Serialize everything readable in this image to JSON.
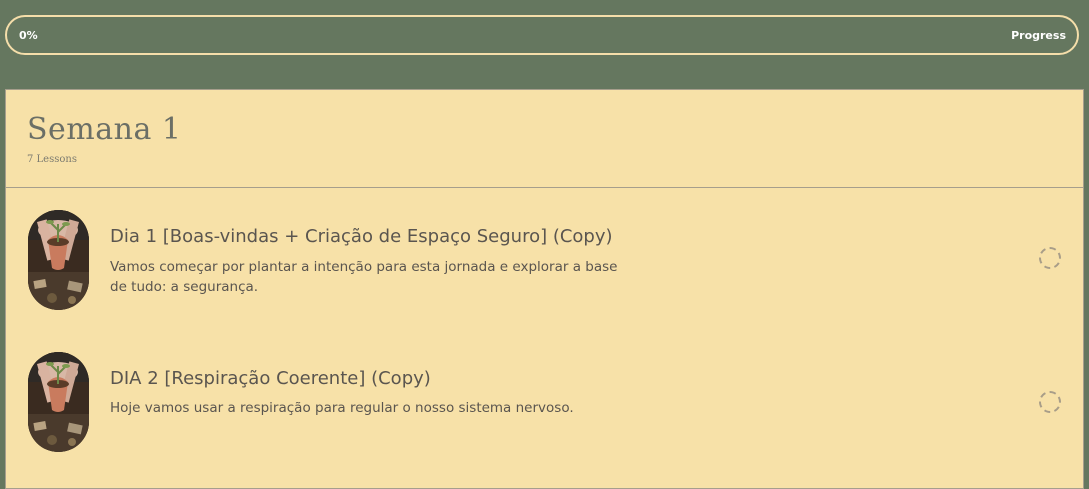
{
  "progress": {
    "percent_label": "0%",
    "label": "Progress",
    "value": 0
  },
  "section": {
    "title": "Semana 1",
    "subtitle": "7 Lessons"
  },
  "lessons": [
    {
      "title": "Dia 1 [Boas-vindas + Criação de Espaço Seguro] (Copy)",
      "description": "Vamos começar por plantar a intenção para esta jornada e explorar a base de tudo: a segurança.",
      "thumbnail_icon": "lesson-thumbnail",
      "status_icon": "incomplete-status-icon"
    },
    {
      "title": "DIA 2 [Respiração Coerente] (Copy)",
      "description": "Hoje vamos usar a respiração para regular o nosso sistema nervoso.",
      "thumbnail_icon": "lesson-thumbnail",
      "status_icon": "incomplete-status-icon"
    }
  ],
  "colors": {
    "background": "#65775f",
    "panel": "#f7e1a8",
    "accent": "#f5deaa",
    "text": "#5a554f"
  }
}
